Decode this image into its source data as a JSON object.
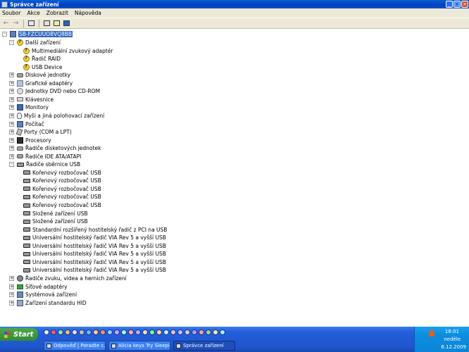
{
  "window": {
    "title": "Správce zařízení",
    "minimize": "_",
    "maximize": "□",
    "close": "×"
  },
  "menu": [
    "Soubor",
    "Akce",
    "Zobrazit",
    "Nápověda"
  ],
  "toolbar": {
    "back_glyph": "←",
    "forward_glyph": "→"
  },
  "tree": {
    "root": "SB-FZCUUO8VQ8BB",
    "items": [
      {
        "label": "Další zařízení",
        "expander": "-",
        "level": 1,
        "icon": "warn"
      },
      {
        "label": "Multimediální zvukový adaptér",
        "level": 2,
        "icon": "warn"
      },
      {
        "label": "Řadič RAID",
        "level": 2,
        "icon": "warn"
      },
      {
        "label": "USB Device",
        "level": 2,
        "icon": "warn"
      },
      {
        "label": "Diskové jednotky",
        "expander": "+",
        "level": 1,
        "icon": "disk"
      },
      {
        "label": "Grafické adaptéry",
        "expander": "+",
        "level": 1,
        "icon": "generic"
      },
      {
        "label": "Jednotky DVD nebo CD-ROM",
        "expander": "+",
        "level": 1,
        "icon": "cd"
      },
      {
        "label": "Klávesnice",
        "expander": "+",
        "level": 1,
        "icon": "kbd"
      },
      {
        "label": "Monitory",
        "expander": "+",
        "level": 1,
        "icon": "monitor"
      },
      {
        "label": "Myši a jiná polohovací zařízení",
        "expander": "+",
        "level": 1,
        "icon": "mouse"
      },
      {
        "label": "Počítač",
        "expander": "+",
        "level": 1,
        "icon": "computer"
      },
      {
        "label": "Porty (COM a LPT)",
        "expander": "+",
        "level": 1,
        "icon": "port"
      },
      {
        "label": "Procesory",
        "expander": "+",
        "level": 1,
        "icon": "cpu"
      },
      {
        "label": "Řadiče disketových jednotek",
        "expander": "+",
        "level": 1,
        "icon": "disk"
      },
      {
        "label": "Řadiče IDE ATA/ATAPI",
        "expander": "+",
        "level": 1,
        "icon": "disk"
      },
      {
        "label": "Řadiče sběrnice USB",
        "expander": "-",
        "level": 1,
        "icon": "usb"
      },
      {
        "label": "Kořenový rozbočovač USB",
        "level": 2,
        "icon": "usb"
      },
      {
        "label": "Kořenový rozbočovač USB",
        "level": 2,
        "icon": "usb"
      },
      {
        "label": "Kořenový rozbočovač USB",
        "level": 2,
        "icon": "usb"
      },
      {
        "label": "Kořenový rozbočovač USB",
        "level": 2,
        "icon": "usb"
      },
      {
        "label": "Kořenový rozbočovač USB",
        "level": 2,
        "icon": "usb"
      },
      {
        "label": "Složené zařízení USB",
        "level": 2,
        "icon": "usb"
      },
      {
        "label": "Složené zařízení USB",
        "level": 2,
        "icon": "usb"
      },
      {
        "label": "Standardní rozšířený hostitelský řadič z PCI na USB",
        "level": 2,
        "icon": "usb"
      },
      {
        "label": "Universální hostitelský řadič VIA Rev 5 a vyšší USB",
        "level": 2,
        "icon": "usb"
      },
      {
        "label": "Universální hostitelský řadič VIA Rev 5 a vyšší USB",
        "level": 2,
        "icon": "usb"
      },
      {
        "label": "Universální hostitelský řadič VIA Rev 5 a vyšší USB",
        "level": 2,
        "icon": "usb"
      },
      {
        "label": "Universální hostitelský řadič VIA Rev 5 a vyšší USB",
        "level": 2,
        "icon": "usb"
      },
      {
        "label": "Universální hostitelský řadič VIA Rev 5 a vyšší USB",
        "level": 2,
        "icon": "usb"
      },
      {
        "label": "Řadiče zvuku, videa a herních zařízení",
        "expander": "+",
        "level": 1,
        "icon": "sound"
      },
      {
        "label": "Síťové adaptéry",
        "expander": "+",
        "level": 1,
        "icon": "net"
      },
      {
        "label": "Systémová zařízení",
        "expander": "+",
        "level": 1,
        "icon": "sys"
      },
      {
        "label": "Zařízení standardu HID",
        "expander": "+",
        "level": 1,
        "icon": "hid"
      }
    ]
  },
  "taskbar": {
    "start_label": "Start",
    "tasks": [
      {
        "label": "Odpověď | Poradte c...",
        "active": false
      },
      {
        "label": "Alicia keys Try Sleepi...",
        "active": false
      },
      {
        "label": "Správce zařízení",
        "active": true
      }
    ],
    "clock_time": "18:01",
    "clock_day": "neděle",
    "clock_date": "6.12.2009"
  }
}
